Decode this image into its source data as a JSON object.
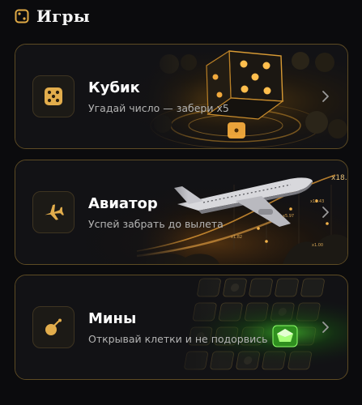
{
  "header": {
    "title": "Игры",
    "icon": "dice-icon"
  },
  "colors": {
    "accent": "#e0aa45",
    "card_border": "#5d4b24",
    "background": "#0b0b0d"
  },
  "games": [
    {
      "id": "dice",
      "title": "Кубик",
      "subtitle": "Угадай число — забери x5",
      "icon": "dice-icon"
    },
    {
      "id": "aviator",
      "title": "Авиатор",
      "subtitle": "Успей забрать до вылета",
      "icon": "airplane-icon",
      "art_labels": [
        "x18.7",
        "x12.43",
        "x5.97",
        "x1.82",
        "x1.00"
      ]
    },
    {
      "id": "mines",
      "title": "Мины",
      "subtitle": "Открывай клетки и не подорвись",
      "icon": "bomb-icon"
    }
  ]
}
